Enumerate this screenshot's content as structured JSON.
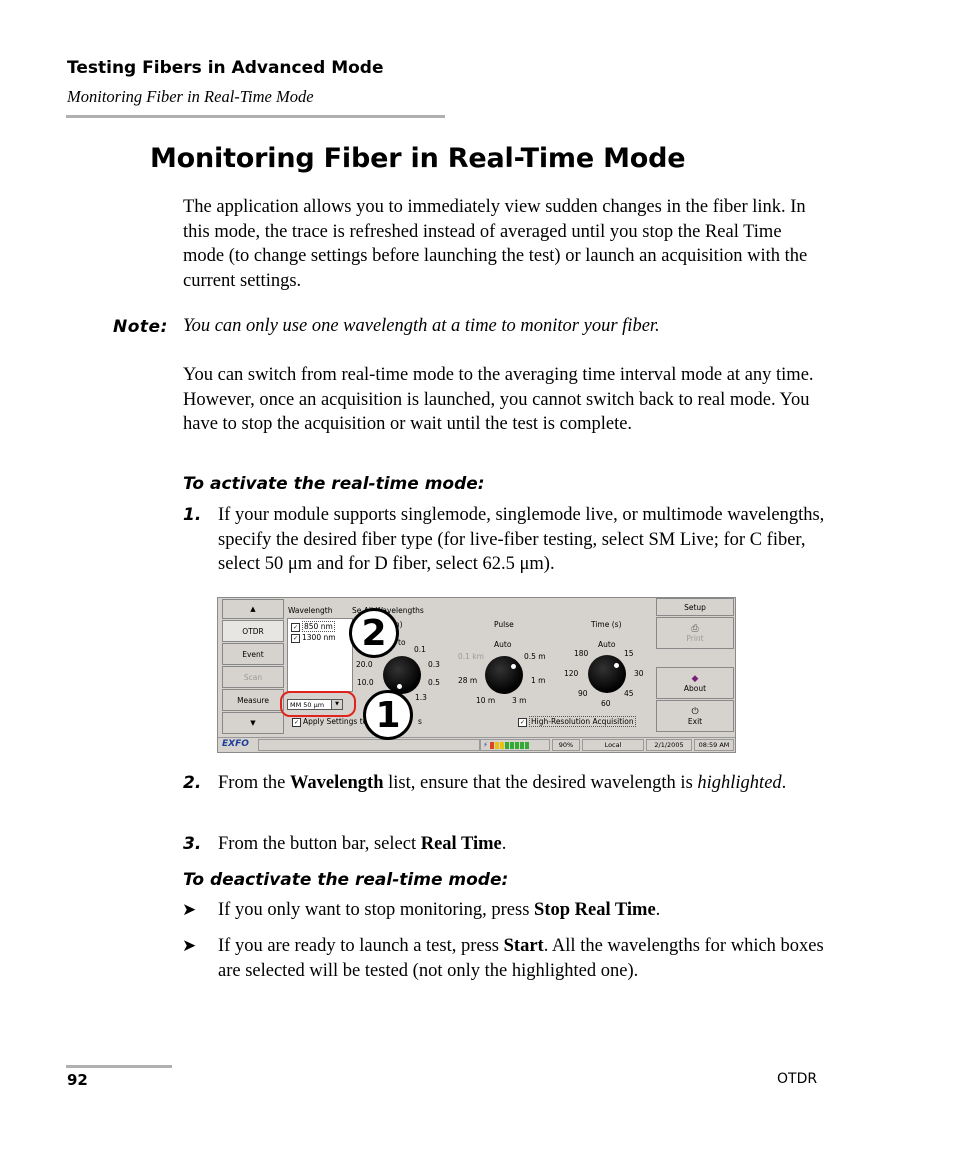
{
  "header": {
    "chapter": "Testing Fibers in Advanced Mode",
    "section": "Monitoring Fiber in Real-Time Mode"
  },
  "title": "Monitoring Fiber in Real-Time Mode",
  "intro": "The application allows you to immediately view sudden changes in the fiber link. In this mode, the trace is refreshed instead of averaged until you stop the Real Time mode (to change settings before launching the test) or launch an acquisition with the current settings.",
  "note": {
    "label": "Note:",
    "text": "You can only use one wavelength at a time to monitor your fiber."
  },
  "para2": "You can switch from real-time mode to the averaging time interval mode at any time. However, once an acquisition is launched, you cannot switch back to real mode. You have to stop the acquisition or wait until the test is complete.",
  "activate": {
    "heading": "To activate the real-time mode:",
    "steps": [
      {
        "num": "1.",
        "text": "If your module supports singlemode, singlemode live, or multimode wavelengths, specify the desired fiber type (for live-fiber testing, select SM Live; for C fiber, select 50 μm and for D fiber, select 62.5 μm)."
      },
      {
        "num": "2.",
        "pre": "From the ",
        "bold": "Wavelength",
        "mid": " list, ensure that the desired wavelength is ",
        "italic": "highlighted",
        "post": "."
      },
      {
        "num": "3.",
        "pre": "From the button bar, select ",
        "bold": "Real Time",
        "post": "."
      }
    ]
  },
  "deactivate": {
    "heading": "To deactivate the real-time mode:",
    "bullets": [
      {
        "pre": "If you only want to stop monitoring, press ",
        "bold": "Stop Real Time",
        "post": "."
      },
      {
        "pre": "If you are ready to launch a test, press ",
        "bold": "Start",
        "post": ". All the wavelengths for which boxes are selected will be tested (not only the highlighted one)."
      }
    ]
  },
  "screenshot": {
    "left_buttons": [
      "OTDR",
      "Event",
      "Scan",
      "Measure"
    ],
    "wavelength_label": "Wavelength",
    "wavelengths": [
      "850 nm",
      "1300 nm"
    ],
    "select_all": "Se   All Wavelengths",
    "range_label": "e (km)",
    "range_ticks": [
      "0.1",
      "0.3",
      "0.5",
      "1.3",
      "20.0",
      "10.0",
      "to"
    ],
    "pulse_label": "Pulse",
    "pulse_ticks": [
      "Auto",
      "0.1 km",
      "0.5 m",
      "28 m",
      "1 m",
      "10 m",
      "3 m"
    ],
    "time_label": "Time (s)",
    "time_ticks": [
      "Auto",
      "180",
      "15",
      "120",
      "30",
      "90",
      "45",
      "60"
    ],
    "fiber_select": "MM 50 μm",
    "apply_settings": "Apply Settings to",
    "apply_suffix": "s",
    "high_res": "High-Resolution Acquisition",
    "right_buttons": [
      "Setup",
      "Print",
      "About",
      "Exit"
    ],
    "status": {
      "brand": "EXFO",
      "battery": "90%",
      "mode": "Local",
      "date": "2/1/2005",
      "time": "08:59 AM"
    },
    "callouts": [
      "2",
      "1"
    ]
  },
  "footer": {
    "page": "92",
    "product": "OTDR"
  }
}
